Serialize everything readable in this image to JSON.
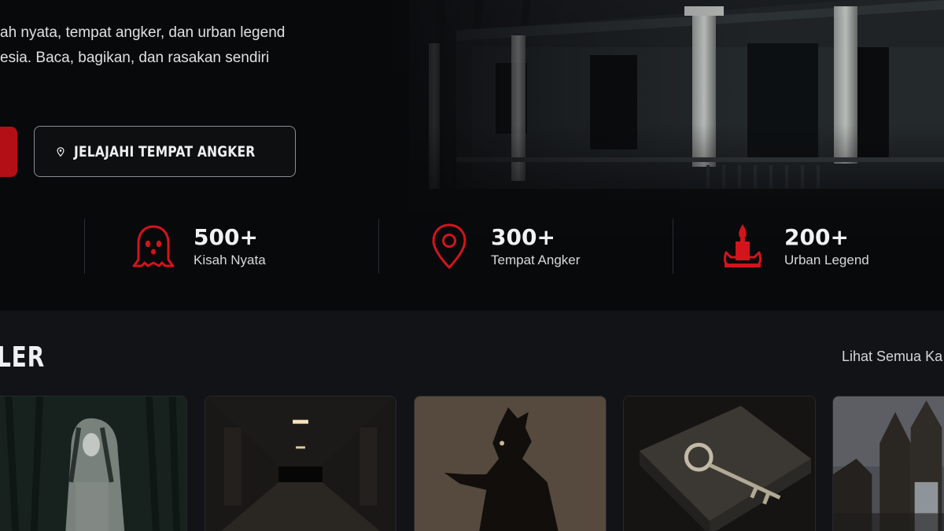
{
  "hero": {
    "description_lines": [
      "ah nyata, tempat angker, dan urban legend",
      "esia. Baca, bagikan, dan rasakan sendiri"
    ],
    "explore_button_label": "JELAJAHI TEMPAT ANGKER"
  },
  "stats": [
    {
      "icon": "ghost-icon",
      "number": "500+",
      "label": "Kisah Nyata"
    },
    {
      "icon": "location-pin-icon",
      "number": "300+",
      "label": "Tempat Angker"
    },
    {
      "icon": "candle-icon",
      "number": "200+",
      "label": "Urban Legend"
    }
  ],
  "section": {
    "title": "LER",
    "see_all_label": "Lihat Semua Ka"
  },
  "cards": [
    {
      "image": "ghost-woman-forest-image"
    },
    {
      "image": "dark-corridor-image"
    },
    {
      "image": "shadow-demon-image"
    },
    {
      "image": "old-book-key-image"
    },
    {
      "image": "temple-gate-image"
    }
  ],
  "colors": {
    "accent_red": "#b30f17",
    "icon_red": "#d3141c",
    "background": "#0b0c0f",
    "section_background": "#121317"
  }
}
